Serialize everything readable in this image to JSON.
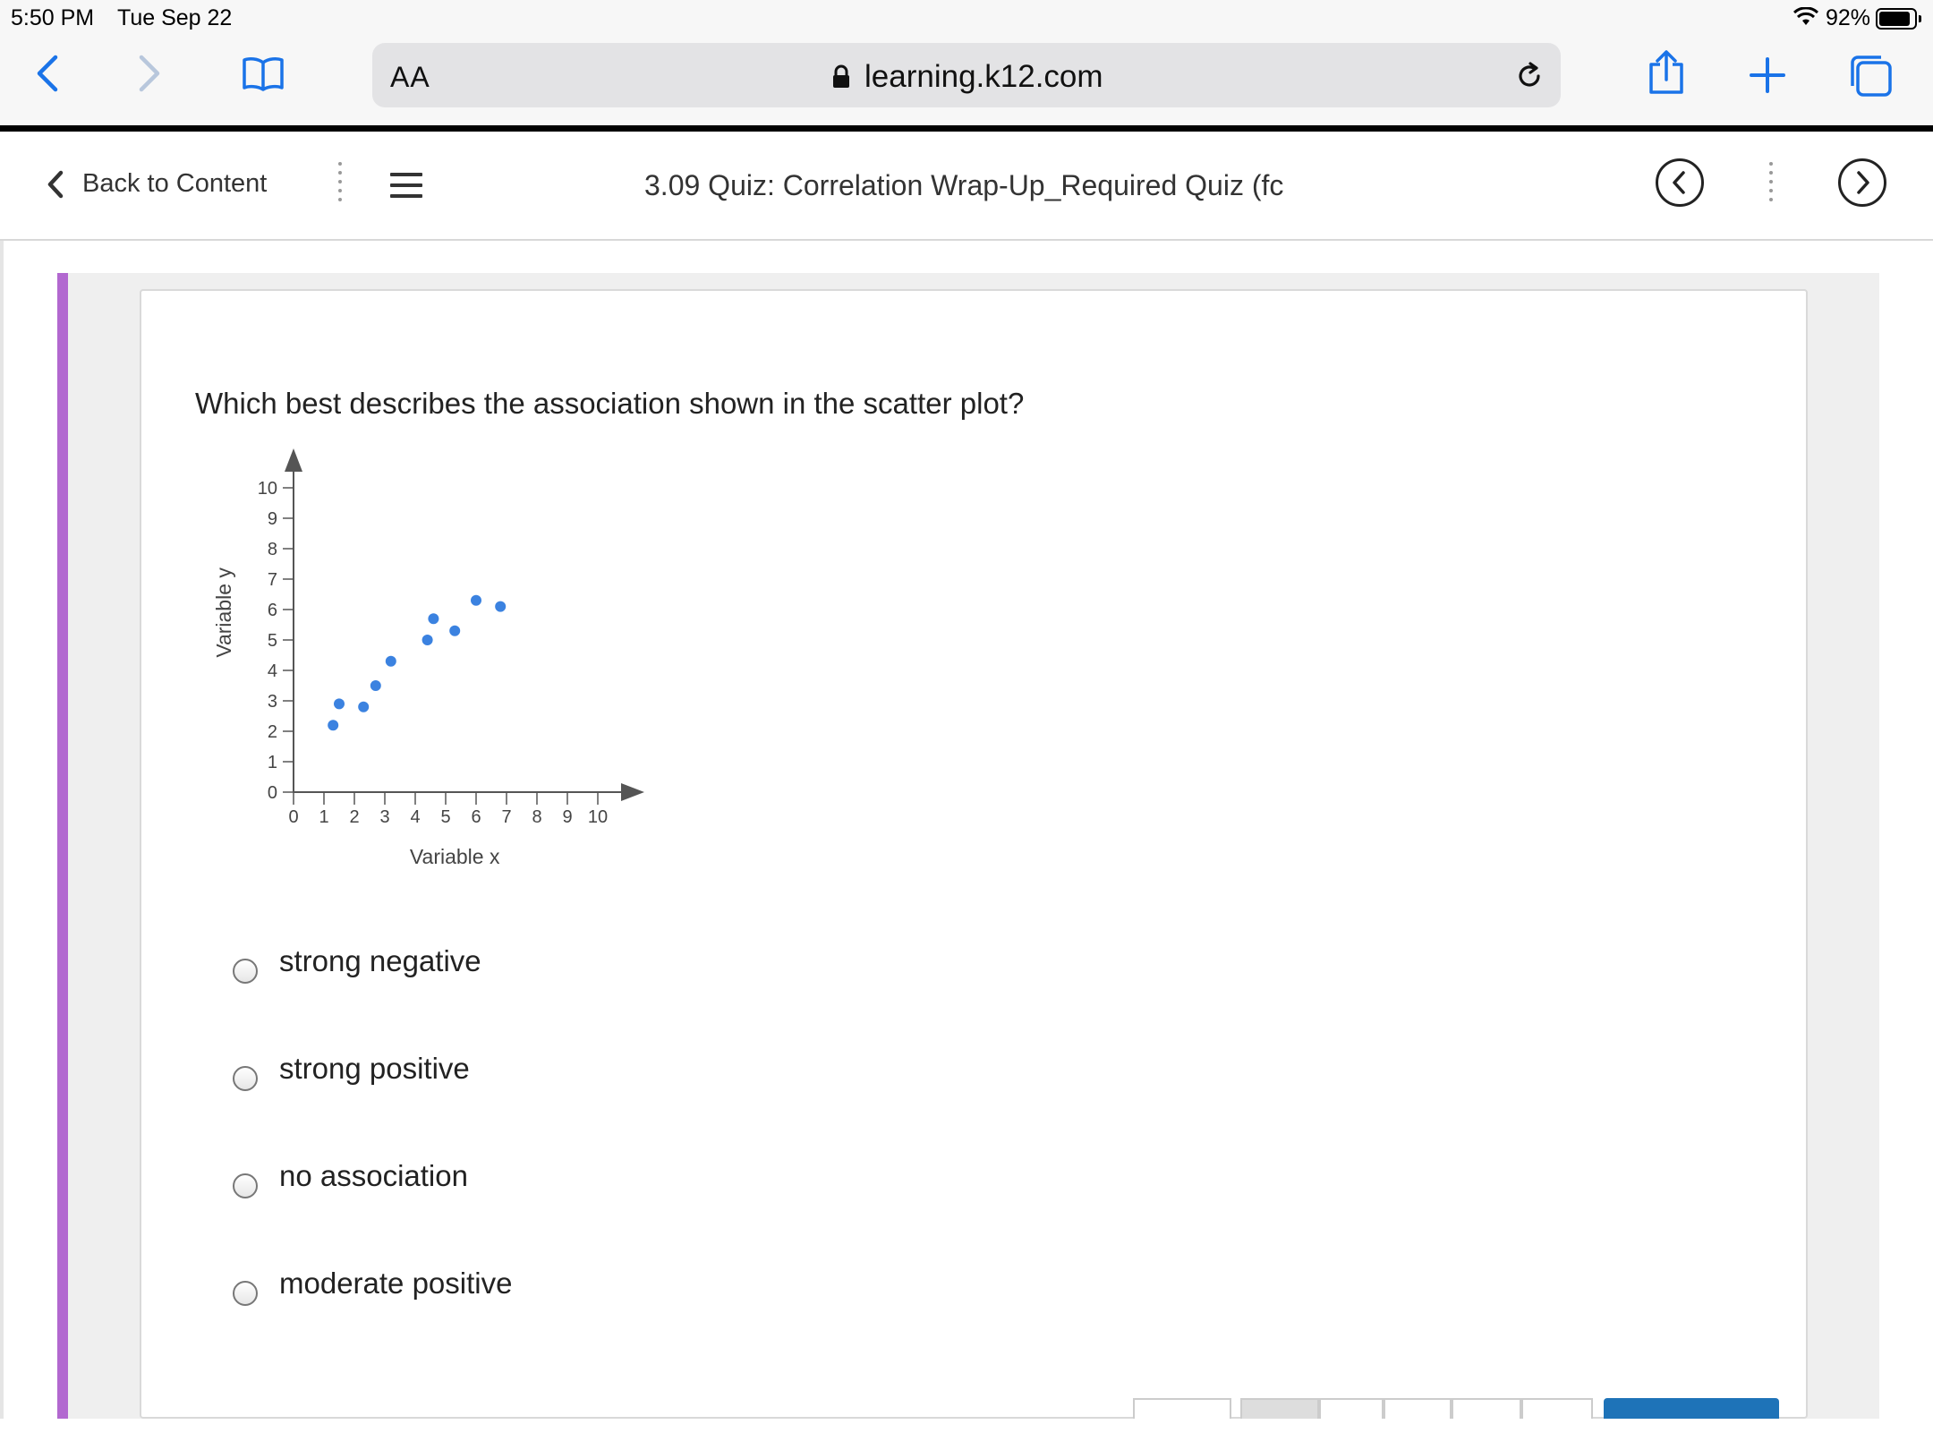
{
  "status_bar": {
    "time": "5:50 PM",
    "date": "Tue Sep 22",
    "battery": "92%"
  },
  "browser": {
    "text_size_button": "AA",
    "url": "learning.k12.com"
  },
  "header": {
    "back_label": "Back to Content",
    "title": "3.09 Quiz: Correlation Wrap-Up_Required Quiz (fc"
  },
  "question": {
    "prompt": "Which best describes the association shown in the scatter plot?",
    "choices": [
      {
        "label": "strong negative"
      },
      {
        "label": "strong positive"
      },
      {
        "label": "no association"
      },
      {
        "label": "moderate positive"
      }
    ]
  },
  "colors": {
    "accent": "#b268d0",
    "point": "#3b82e0",
    "submit": "#1e73b8"
  },
  "chart_data": {
    "type": "scatter",
    "title": "",
    "xlabel": "Variable x",
    "ylabel": "Variable y",
    "xlim": [
      0,
      10
    ],
    "ylim": [
      0,
      10
    ],
    "xticks": [
      "0",
      "1",
      "2",
      "3",
      "4",
      "5",
      "6",
      "7",
      "8",
      "9",
      "10"
    ],
    "yticks": [
      "0",
      "1",
      "2",
      "3",
      "4",
      "5",
      "6",
      "7",
      "8",
      "9",
      "10"
    ],
    "grid": false,
    "points": [
      {
        "x": 1.3,
        "y": 2.2
      },
      {
        "x": 1.5,
        "y": 2.9
      },
      {
        "x": 2.3,
        "y": 2.8
      },
      {
        "x": 2.7,
        "y": 3.5
      },
      {
        "x": 3.2,
        "y": 4.3
      },
      {
        "x": 4.4,
        "y": 5.0
      },
      {
        "x": 4.6,
        "y": 5.7
      },
      {
        "x": 5.3,
        "y": 5.3
      },
      {
        "x": 6.0,
        "y": 6.3
      },
      {
        "x": 6.8,
        "y": 6.1
      }
    ]
  }
}
